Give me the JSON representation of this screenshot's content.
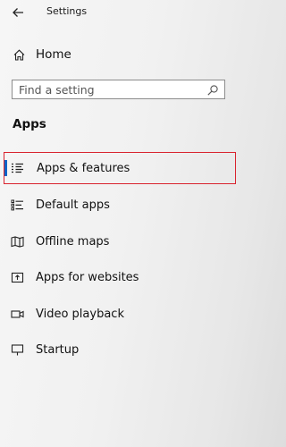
{
  "window": {
    "title": "Settings",
    "back_icon": "back-arrow-icon"
  },
  "home": {
    "label": "Home",
    "icon": "home-icon"
  },
  "search": {
    "placeholder": "Find a setting",
    "value": "",
    "icon": "search-icon"
  },
  "section": {
    "title": "Apps"
  },
  "nav": {
    "items": [
      {
        "label": "Apps & features",
        "icon": "apps-features-icon",
        "selected": true
      },
      {
        "label": "Default apps",
        "icon": "default-apps-icon",
        "selected": false
      },
      {
        "label": "Offline maps",
        "icon": "offline-maps-icon",
        "selected": false
      },
      {
        "label": "Apps for websites",
        "icon": "apps-websites-icon",
        "selected": false
      },
      {
        "label": "Video playback",
        "icon": "video-playback-icon",
        "selected": false
      },
      {
        "label": "Startup",
        "icon": "startup-icon",
        "selected": false
      }
    ]
  },
  "colors": {
    "accent": "#0a64c8",
    "highlight_border": "#d9232e"
  }
}
